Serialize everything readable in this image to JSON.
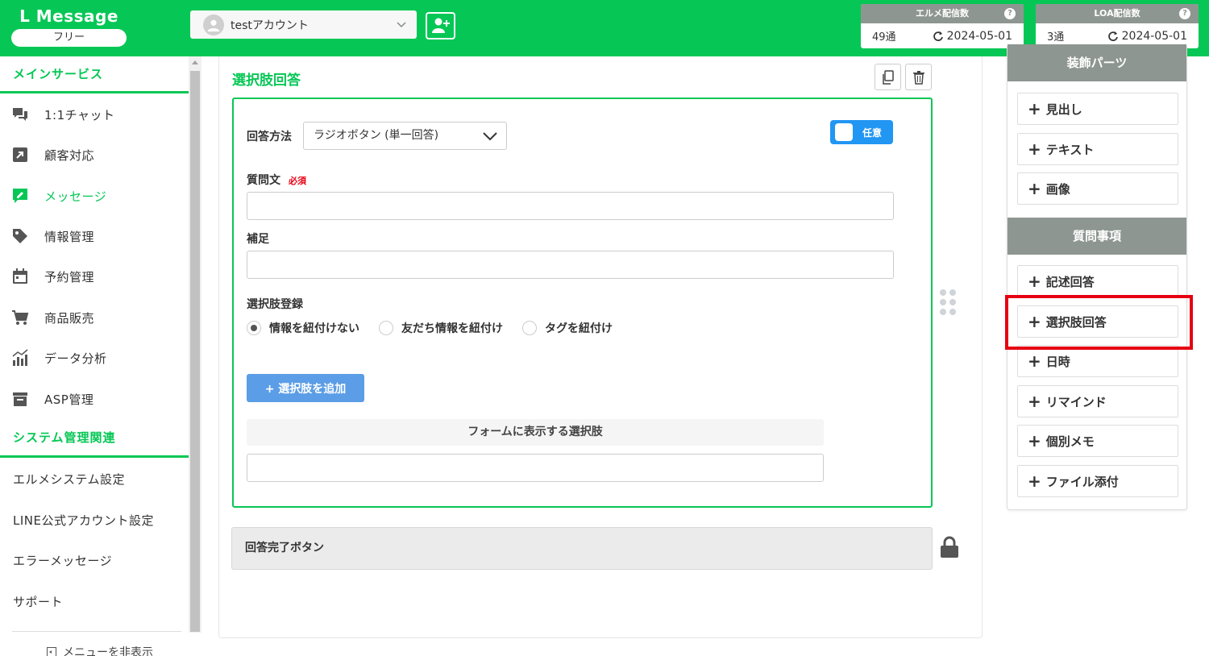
{
  "header": {
    "logo_title": "L Message",
    "plan": "フリー",
    "account_name": "testアカウント",
    "quotas": [
      {
        "title": "エルメ配信数",
        "count": "49通",
        "date": "2024-05-01"
      },
      {
        "title": "LOA配信数",
        "count": "3通",
        "date": "2024-05-01"
      }
    ],
    "help_mark": "?"
  },
  "sidebar": {
    "section_main": "メインサービス",
    "items": [
      {
        "label": "1:1チャット",
        "icon": "chat-icon"
      },
      {
        "label": "顧客対応",
        "icon": "arrow-box-icon"
      },
      {
        "label": "メッセージ",
        "icon": "message-edit-icon",
        "active": true
      },
      {
        "label": "情報管理",
        "icon": "tag-icon"
      },
      {
        "label": "予約管理",
        "icon": "calendar-icon"
      },
      {
        "label": "商品販売",
        "icon": "cart-icon"
      },
      {
        "label": "データ分析",
        "icon": "chart-icon"
      },
      {
        "label": "ASP管理",
        "icon": "box-icon"
      }
    ],
    "section_system": "システム管理関連",
    "system_items": [
      "エルメシステム設定",
      "LINE公式アカウント設定",
      "エラーメッセージ",
      "サポート"
    ],
    "hide_menu": "メニューを非表示"
  },
  "block": {
    "title": "選択肢回答",
    "answer_method_label": "回答方法",
    "answer_method_value": "ラジオボタン (単一回答)",
    "toggle_label": "任意",
    "question_label": "質問文",
    "required_label": "必須",
    "supplement_label": "補足",
    "choice_register_label": "選択肢登録",
    "radio_options": [
      {
        "label": "情報を紐付けない",
        "checked": true
      },
      {
        "label": "友だち情報を紐付け",
        "checked": false
      },
      {
        "label": "タグを紐付け",
        "checked": false
      }
    ],
    "add_choice_button": "+ 選択肢を追加",
    "choices_header": "フォームに表示する選択肢"
  },
  "complete_button_label": "回答完了ボタン",
  "right_panel": {
    "decor_head": "装飾パーツ",
    "decor_items": [
      "見出し",
      "テキスト",
      "画像"
    ],
    "question_head": "質問事項",
    "question_items": [
      "記述回答",
      "選択肢回答",
      "日時",
      "リマインド",
      "個別メモ",
      "ファイル添付"
    ],
    "highlighted_item": "選択肢回答"
  },
  "colors": {
    "brand_green": "#06c755",
    "toggle_blue": "#2196f3",
    "highlight_red": "#e60012",
    "panel_head_gray": "#8e9691"
  }
}
